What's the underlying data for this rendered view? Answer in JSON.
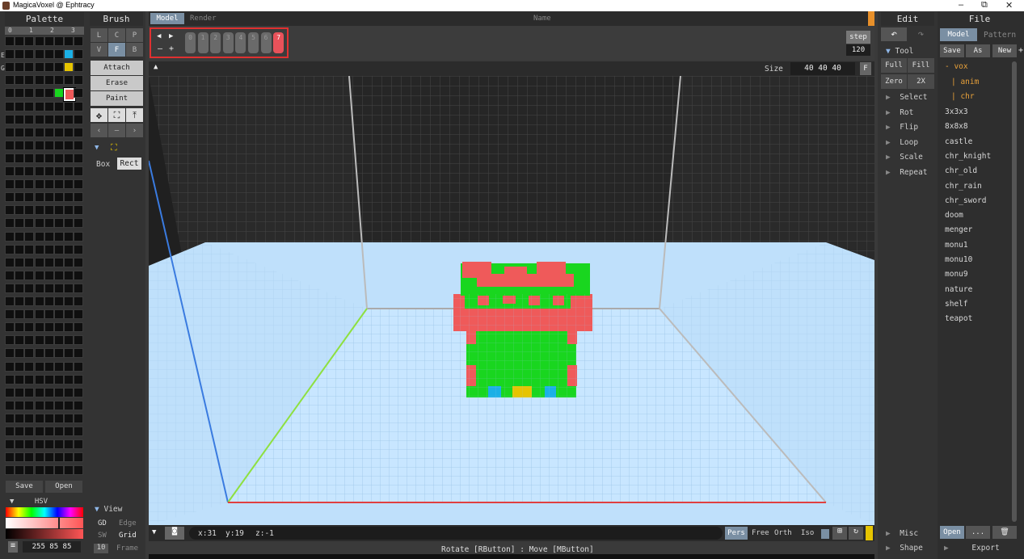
{
  "window": {
    "title": "MagicaVoxel @ Ephtracy",
    "minimize": "–",
    "restore": "⧉",
    "close": "✕"
  },
  "palette": {
    "header": "Palette",
    "tabs": [
      "0",
      "1",
      "2",
      "3"
    ],
    "side_labels": [
      "E",
      "G"
    ],
    "save": "Save",
    "open": "Open",
    "hsv": "HSV",
    "color_value": "255 85 85"
  },
  "brush": {
    "header": "Brush",
    "modes_row1": [
      "L",
      "C",
      "P"
    ],
    "modes_row2": [
      "V",
      "F",
      "B"
    ],
    "actions": [
      "Attach",
      "Erase",
      "Paint"
    ],
    "nav": [
      "‹",
      "–",
      "›"
    ],
    "shape_opts": [
      "Box",
      "Rect"
    ],
    "view_label": "View",
    "view_opts": [
      [
        "GD",
        "Edge"
      ],
      [
        "SW",
        "Grid"
      ],
      [
        "10",
        "Frame"
      ]
    ]
  },
  "viewport": {
    "tabs": [
      "Model",
      "Render"
    ],
    "name_label": "Name",
    "frames": [
      "0",
      "1",
      "2",
      "3",
      "4",
      "5",
      "6",
      "7"
    ],
    "active_frame": "7",
    "step_label": "step",
    "step_value": "120",
    "size_label": "Size",
    "size_value": "40 40 40",
    "size_btn": "F",
    "coords": {
      "x": "x:31",
      "y": "y:19",
      "z": "z:-1"
    },
    "proj": [
      "Pers",
      "Free",
      "Orth",
      "Iso"
    ],
    "status": "Rotate [RButton] : Move [MButton]"
  },
  "edit": {
    "header": "Edit",
    "undo": "↶",
    "redo": "↷",
    "tool_label": "Tool",
    "tool_btns": [
      [
        "Full",
        "Fill"
      ],
      [
        "Zero",
        "2X"
      ]
    ],
    "items": [
      "Select",
      "Rot",
      "Flip",
      "Loop",
      "Scale",
      "Repeat"
    ],
    "misc": "Misc",
    "shape": "Shape"
  },
  "file": {
    "header": "File",
    "tabs": [
      "Model",
      "Pattern"
    ],
    "actions": [
      "Save",
      "As",
      "New",
      "+"
    ],
    "folder": "- vox",
    "subfolders": [
      "| anim",
      "| chr"
    ],
    "files": [
      "3x3x3",
      "8x8x8",
      "castle",
      "chr_knight",
      "chr_old",
      "chr_rain",
      "chr_sword",
      "doom",
      "menger",
      "monu1",
      "monu10",
      "monu9",
      "nature",
      "shelf",
      "teapot"
    ],
    "open": "Open",
    "more": "...",
    "trash": "🗑",
    "export": "Export"
  },
  "colors": {
    "accent": "#7a8fa3",
    "selected": "#e8525a",
    "green": "#19d61f",
    "red": "#ef5a5a",
    "blue": "#1bb0e6",
    "yellow": "#e6c400"
  }
}
